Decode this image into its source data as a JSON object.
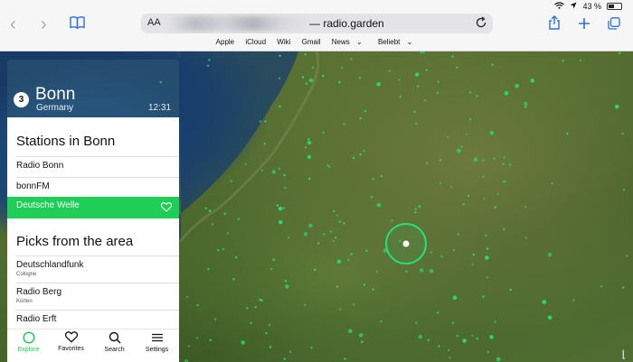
{
  "status": {
    "battery": "43 %"
  },
  "browser": {
    "aa_label": "AA",
    "url": "— radio.garden",
    "favorites": [
      "Apple",
      "iCloud",
      "Wiki",
      "Gmail",
      "News",
      "Beliebt"
    ]
  },
  "city": {
    "number": "3",
    "name": "Bonn",
    "country": "Germany",
    "time": "12:31"
  },
  "sections": {
    "stations_title": "Stations in Bonn",
    "picks_title": "Picks from the area"
  },
  "stations": [
    {
      "name": "Radio Bonn"
    },
    {
      "name": "bonnFM"
    },
    {
      "name": "Deutsche Welle"
    }
  ],
  "picks": [
    {
      "name": "Deutschlandfunk",
      "location": "Cologne"
    },
    {
      "name": "Radio Berg",
      "location": "Kürten"
    },
    {
      "name": "Radio Erft",
      "location": ""
    }
  ],
  "tabs": [
    {
      "label": "Explore"
    },
    {
      "label": "Favorites"
    },
    {
      "label": "Search"
    },
    {
      "label": "Settings"
    }
  ],
  "colors": {
    "accent": "#1fce57",
    "station_dot": "#22e07a"
  }
}
